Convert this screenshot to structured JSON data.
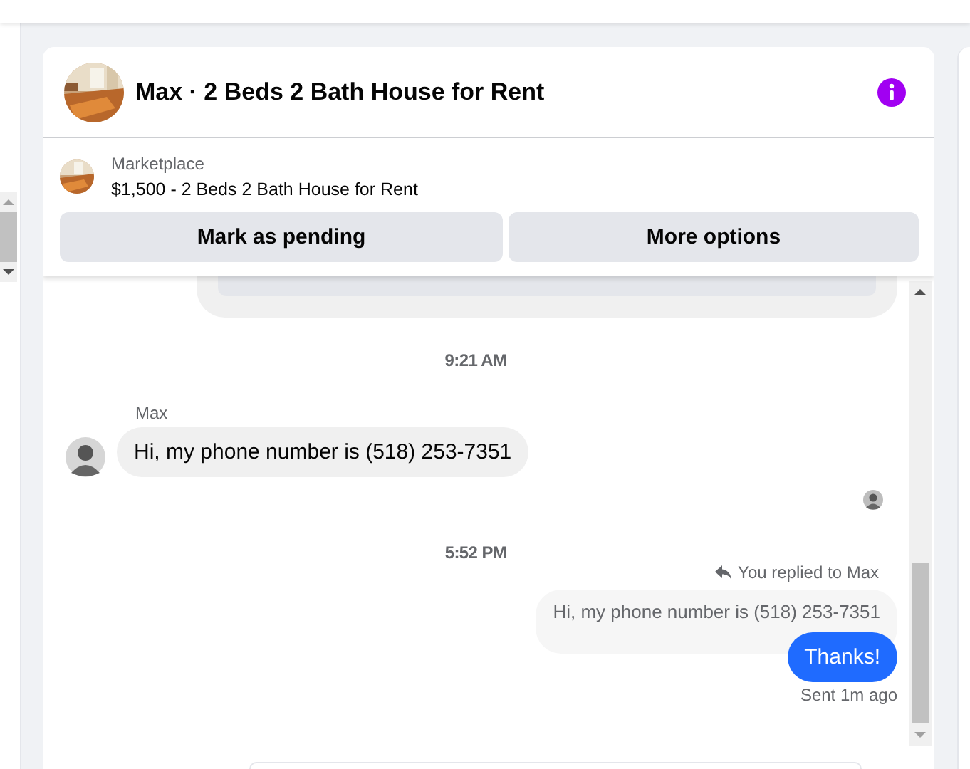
{
  "conversation": {
    "title": "Max · 2 Beds 2 Bath House for Rent"
  },
  "listing": {
    "source": "Marketplace",
    "title": "$1,500 - 2 Beds 2 Bath House for Rent"
  },
  "actions": [
    "Mark as pending",
    "More options"
  ],
  "messages": [
    {
      "kind": "time",
      "text": "9:21 AM"
    },
    {
      "kind": "incoming",
      "sender": "Max",
      "text": "Hi, my phone number is (518) 253-7351"
    },
    {
      "kind": "seen"
    },
    {
      "kind": "time",
      "text": "5:52 PM"
    },
    {
      "kind": "reply",
      "note": "You replied to Max",
      "quote": "Hi, my phone number is (518) 253-7351",
      "text": "Thanks!",
      "status": "Sent 1m ago"
    }
  ]
}
